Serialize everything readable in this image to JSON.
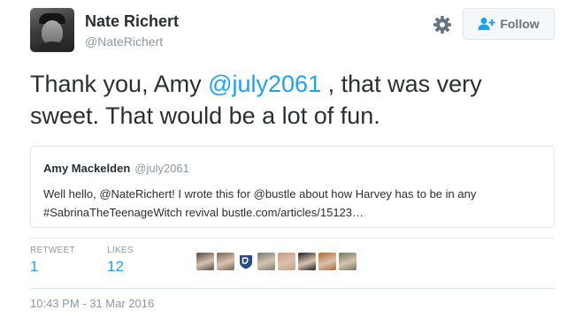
{
  "author": {
    "name": "Nate Richert",
    "handle": "@NateRichert"
  },
  "follow_button": {
    "label": "Follow",
    "icon": "user-plus-icon"
  },
  "tweet": {
    "text_before": "Thank you, Amy ",
    "mention": "@july2061",
    "text_after": " , that was very sweet. That would be a lot of fun."
  },
  "quoted_tweet": {
    "name": "Amy Mackelden",
    "handle": "@july2061",
    "text": "Well hello, @NateRichert! I wrote this for @bustle about how Harvey has to be in any #SabrinaTheTeenageWitch revival bustle.com/articles/15123…"
  },
  "stats": {
    "retweets_label": "RETWEET",
    "retweets_value": "1",
    "likes_label": "LIKES",
    "likes_value": "12"
  },
  "likers": [
    {
      "color": "#4d4a45",
      "icon": "avatar"
    },
    {
      "color": "#7a6454",
      "icon": "avatar"
    },
    {
      "color": "#2c4a86",
      "icon": "dodgers-logo"
    },
    {
      "color": "#6f7d72",
      "icon": "avatar"
    },
    {
      "color": "#c99a82",
      "icon": "avatar"
    },
    {
      "color": "#1f1f1f",
      "icon": "avatar"
    },
    {
      "color": "#b3652f",
      "icon": "avatar"
    },
    {
      "color": "#6b7763",
      "icon": "avatar"
    }
  ],
  "timestamp": "10:43 PM - 31 Mar 2016",
  "colors": {
    "link": "#1da1f2",
    "text": "#292f33",
    "muted": "#8899a6",
    "border": "#e1e8ed"
  }
}
